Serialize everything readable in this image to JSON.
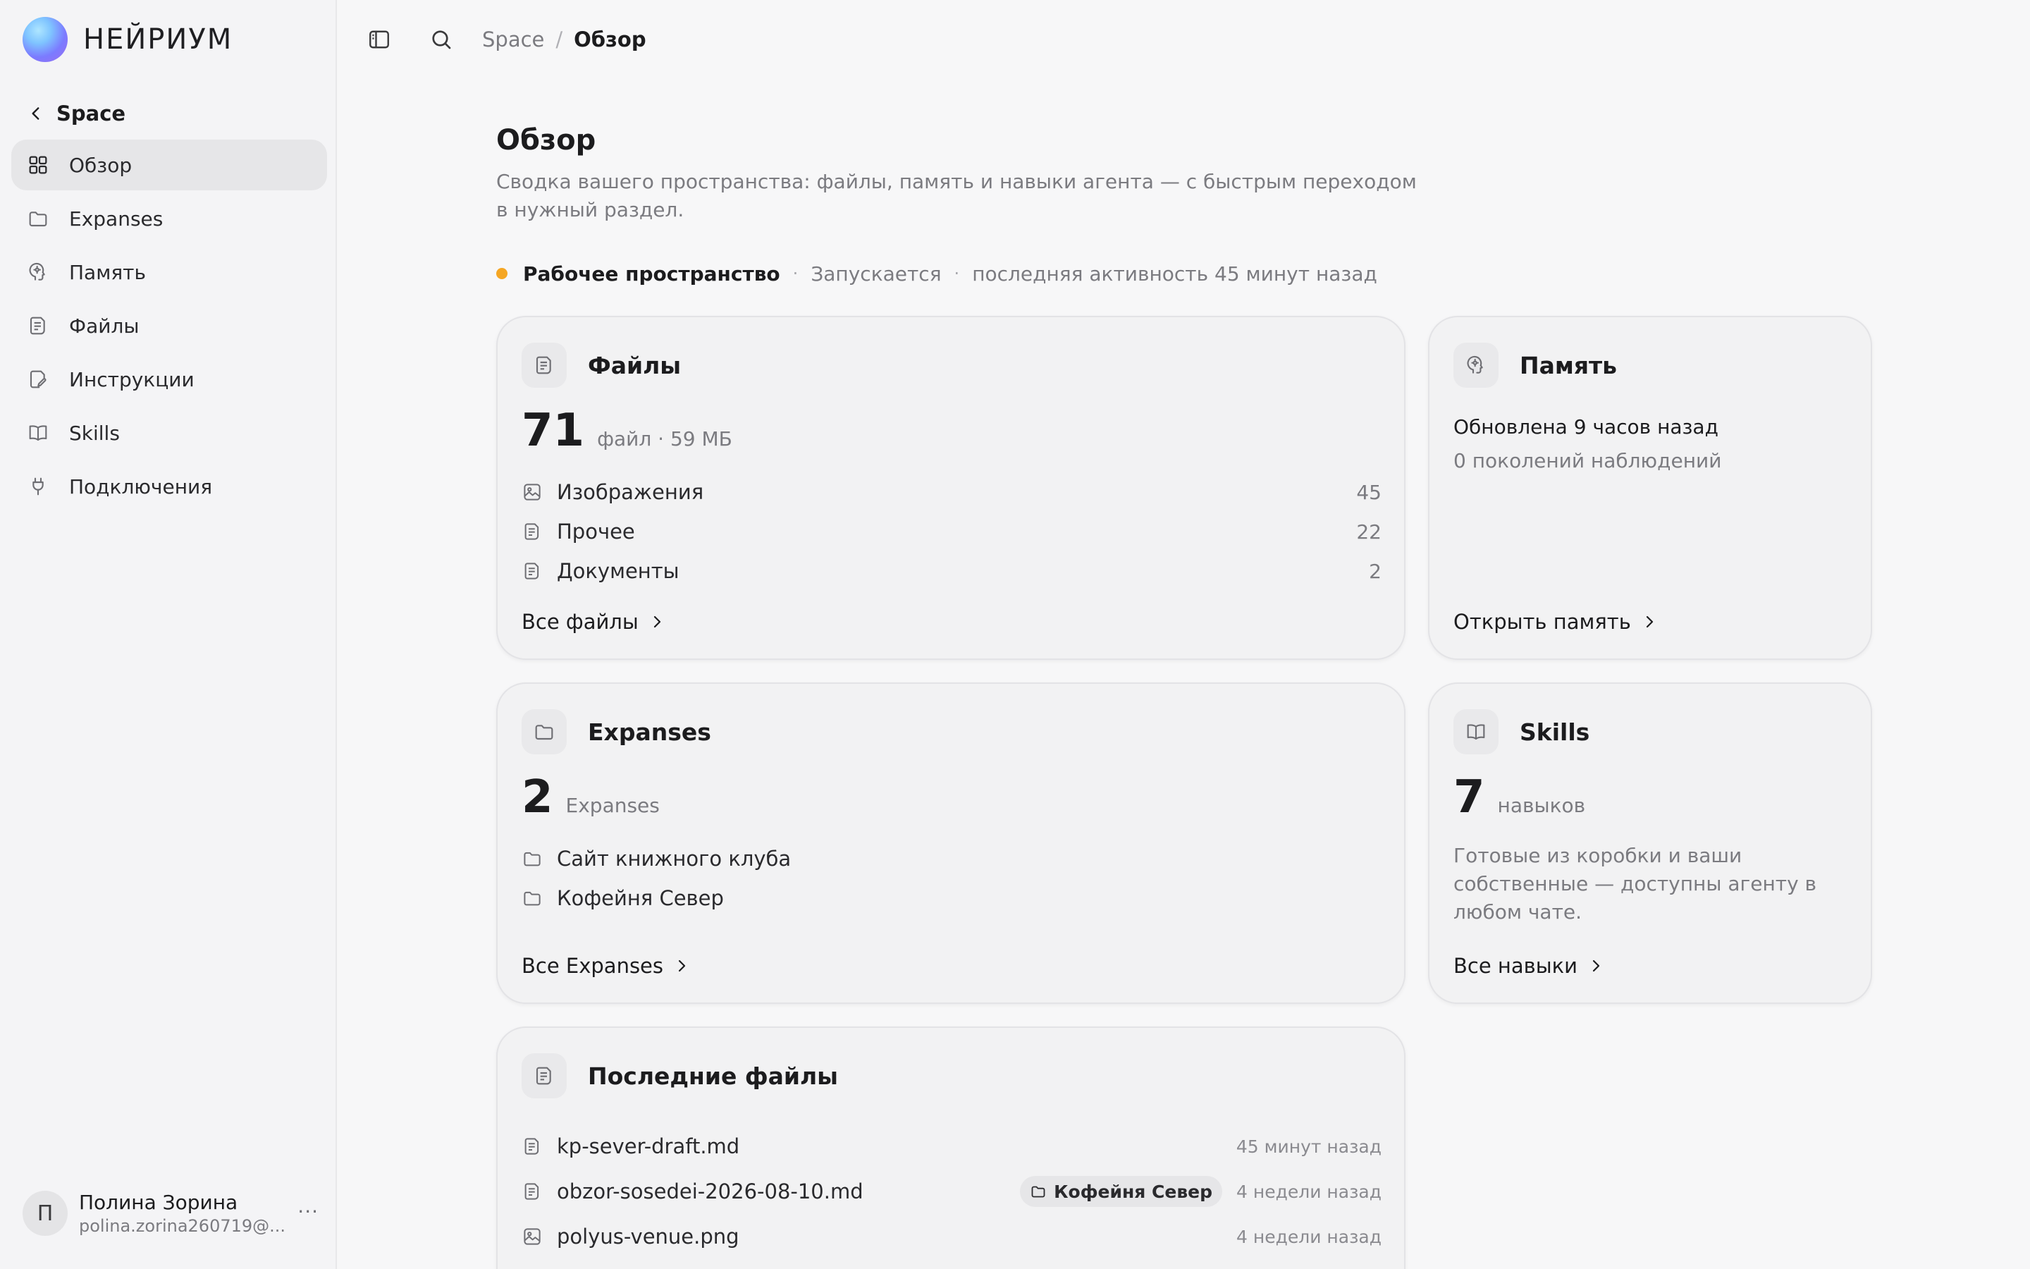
{
  "brand": {
    "name": "НЕЙРИУМ"
  },
  "sidebar": {
    "back_label": "Space",
    "items": [
      {
        "label": "Обзор",
        "icon": "grid-icon",
        "active": true
      },
      {
        "label": "Expanses",
        "icon": "folder-icon"
      },
      {
        "label": "Память",
        "icon": "brain-icon"
      },
      {
        "label": "Файлы",
        "icon": "file-icon"
      },
      {
        "label": "Инструкции",
        "icon": "instructions-icon"
      },
      {
        "label": "Skills",
        "icon": "book-icon"
      },
      {
        "label": "Подключения",
        "icon": "plug-icon"
      }
    ],
    "user": {
      "initial": "П",
      "name": "Полина Зорина",
      "email": "polina.zorina260719@...",
      "more": "···"
    }
  },
  "topbar": {
    "crumbs": [
      "Space",
      "Обзор"
    ],
    "separator": "/"
  },
  "header": {
    "title": "Обзор",
    "subtitle": "Сводка вашего пространства: файлы, память и навыки агента — с быстрым переходом в нужный раздел."
  },
  "status": {
    "name": "Рабочее пространство",
    "state": "Запускается",
    "activity": "последняя активность 45 минут назад",
    "separator": "·",
    "color": "#f5a623"
  },
  "files_card": {
    "title": "Файлы",
    "count": "71",
    "unit": "файл · 59 МБ",
    "rows": [
      {
        "label": "Изображения",
        "count": "45",
        "icon": "image-icon"
      },
      {
        "label": "Прочее",
        "count": "22",
        "icon": "file-icon"
      },
      {
        "label": "Документы",
        "count": "2",
        "icon": "file-icon"
      }
    ],
    "link": "Все файлы"
  },
  "memory_card": {
    "title": "Память",
    "updated": "Обновлена 9 часов назад",
    "generations": "0 поколений наблюдений",
    "link": "Открыть память"
  },
  "expanses_card": {
    "title": "Expanses",
    "count": "2",
    "unit": "Expanses",
    "rows": [
      {
        "label": "Сайт книжного клуба",
        "icon": "folder-icon"
      },
      {
        "label": "Кофейня Север",
        "icon": "folder-icon"
      }
    ],
    "link": "Все Expanses"
  },
  "skills_card": {
    "title": "Skills",
    "count": "7",
    "unit": "навыков",
    "description": "Готовые из коробки и ваши собственные — доступны агенту в любом чате.",
    "link": "Все навыки"
  },
  "recent_card": {
    "title": "Последние файлы",
    "rows": [
      {
        "name": "kp-sever-draft.md",
        "tag": "",
        "time": "45 минут назад",
        "icon": "file-icon"
      },
      {
        "name": "obzor-sosedei-2026-08-10.md",
        "tag": "Кофейня Север",
        "time": "4 недели назад",
        "icon": "file-icon"
      },
      {
        "name": "polyus-venue.png",
        "tag": "",
        "time": "4 недели назад",
        "icon": "image-icon"
      }
    ]
  }
}
